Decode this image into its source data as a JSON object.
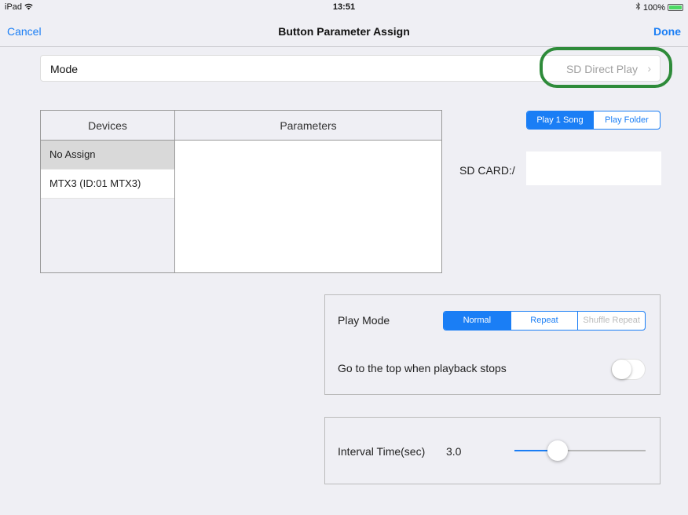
{
  "status_bar": {
    "device": "iPad",
    "wifi_icon": "wifi-icon",
    "time": "13:51",
    "bluetooth_icon": "bluetooth-icon",
    "battery": "100%"
  },
  "nav": {
    "cancel_label": "Cancel",
    "title": "Button Parameter Assign",
    "done_label": "Done"
  },
  "mode": {
    "label": "Mode",
    "value": "SD Direct Play",
    "highlight_color": "#2e8b3a"
  },
  "table": {
    "devices_header": "Devices",
    "parameters_header": "Parameters",
    "devices": [
      {
        "label": "No Assign",
        "selected": true
      },
      {
        "label": "MTX3 (ID:01 MTX3)",
        "selected": false
      }
    ]
  },
  "play_select": {
    "options": [
      "Play 1 Song",
      "Play Folder"
    ],
    "selected": "Play 1 Song"
  },
  "sd_card": {
    "label": "SD CARD:/",
    "value": ""
  },
  "play_mode": {
    "label": "Play Mode",
    "options": [
      "Normal",
      "Repeat",
      "Shuffle Repeat"
    ],
    "selected": "Normal",
    "disabled": [
      "Shuffle Repeat"
    ],
    "stop_top_label": "Go to the top when playback stops",
    "stop_top_on": false
  },
  "interval": {
    "label": "Interval Time(sec)",
    "value": "3.0"
  },
  "colors": {
    "accent": "#1a7ef5",
    "background": "#efeff4"
  }
}
